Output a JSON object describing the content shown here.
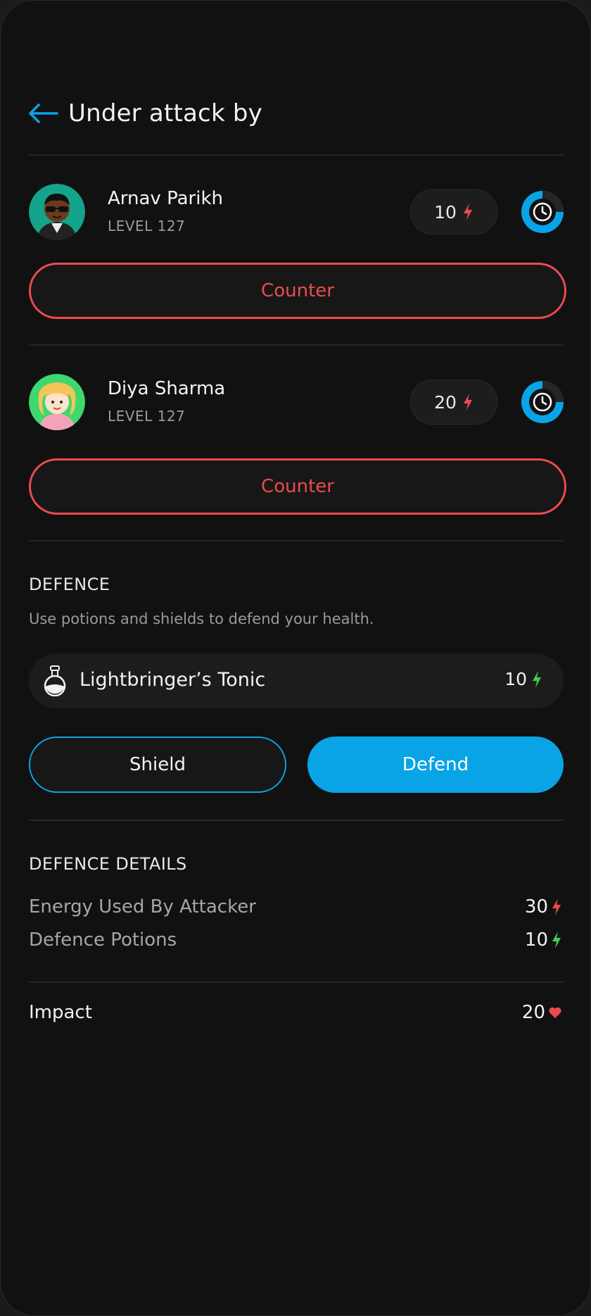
{
  "header": {
    "title": "Under attack by"
  },
  "attackers": [
    {
      "name": "Arnav Parikh",
      "level": "LEVEL 127",
      "energy": "10",
      "counter_label": "Counter"
    },
    {
      "name": "Diya Sharma",
      "level": "LEVEL 127",
      "energy": "20",
      "counter_label": "Counter"
    }
  ],
  "defence": {
    "title": "DEFENCE",
    "subtitle": "Use potions and shields to defend your health.",
    "potion": {
      "name": "Lightbringer’s Tonic",
      "value": "10"
    },
    "shield_label": "Shield",
    "defend_label": "Defend"
  },
  "details": {
    "title": "DEFENCE DETAILS",
    "rows": [
      {
        "label": "Energy Used By Attacker",
        "value": "30"
      },
      {
        "label": "Defence Potions",
        "value": "10"
      }
    ],
    "impact": {
      "label": "Impact",
      "value": "20"
    }
  },
  "icons": {
    "back": "arrow-left-icon",
    "attack_energy": "lightning-bolt-icon",
    "defence_energy": "lightning-bolt-icon",
    "timer": "clock-icon",
    "potion": "potion-flask-icon",
    "impact": "heart-icon"
  },
  "colors": {
    "background": "#111111",
    "accent": "#08a4e6",
    "counter": "#ea4b4e",
    "attack_bolt": "#ea4b4e",
    "defence_bolt": "#3ccf4e",
    "heart": "#ea4b4e"
  }
}
